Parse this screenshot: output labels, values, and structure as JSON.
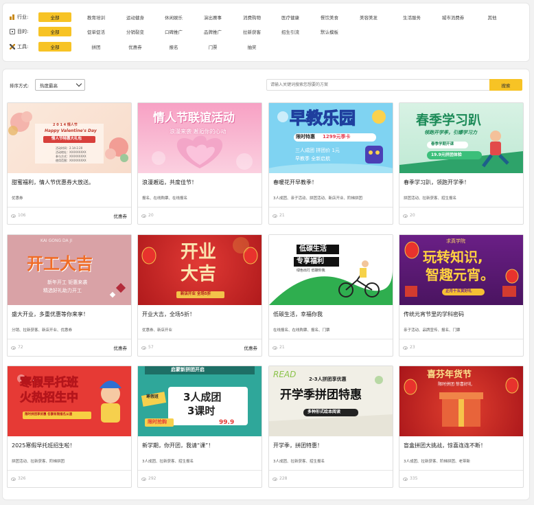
{
  "filters": {
    "industry": {
      "label": "行业:",
      "options": [
        "全部",
        "教育培训",
        "运动健身",
        "休闲娱乐",
        "演出赛事",
        "消费购物",
        "医疗健康",
        "餐饮美食",
        "美容美发",
        "生活服务",
        "城市消费券",
        "其他"
      ]
    },
    "goal": {
      "label": "目的:",
      "options": [
        "全部",
        "促单促活",
        "分销裂变",
        "口碑推广",
        "品牌推广",
        "拉新获客",
        "招生引流",
        "默认模板"
      ]
    },
    "tool": {
      "label": "工具:",
      "options": [
        "全部",
        "拼团",
        "优惠券",
        "报名",
        "门票",
        "抽奖"
      ]
    }
  },
  "sort": {
    "label": "排序方式:",
    "value": "热度最高"
  },
  "search": {
    "placeholder": "请输入关键词搜索您想要的方案",
    "button": "搜索"
  },
  "cards": [
    {
      "title": "甜蜜福利，情人节优惠券大放送。",
      "tags": "优惠券",
      "views": "106",
      "type": "优惠券"
    },
    {
      "title": "浪漫邂逅，共度佳节！",
      "tags": "报名、在线购票、在线报名",
      "views": "20",
      "type": ""
    },
    {
      "title": "春暖花开早教季！",
      "tags": "3人成团、亲子活动、拼团活动、新店开业、阶梯拼团",
      "views": "21",
      "type": ""
    },
    {
      "title": "春季学习趴，领跑开学季！",
      "tags": "拼团活动、拉新获客、招生报名",
      "views": "20",
      "type": ""
    },
    {
      "title": "盛大开业，多重优惠等你来享！",
      "tags": "分销、拉新获客、新店开业、优惠券",
      "views": "72",
      "type": "优惠券"
    },
    {
      "title": "开业大吉，全场5折！",
      "tags": "优惠券、新店开业",
      "views": "57",
      "type": "优惠券"
    },
    {
      "title": "低碳生活，幸福你我",
      "tags": "在线报名、在线购票、报名、门票",
      "views": "21",
      "type": ""
    },
    {
      "title": "传统元宵节里的学科密码",
      "tags": "亲子活动、品牌宣传、报名、门票",
      "views": "23",
      "type": ""
    },
    {
      "title": "2025寒假早托班招生啦！",
      "tags": "拼团活动、拉新获客、阶梯拼团",
      "views": "326",
      "type": ""
    },
    {
      "title": "新学期，你开团，我请“课”！",
      "tags": "3人成团、拉新获客、招生报名",
      "views": "292",
      "type": ""
    },
    {
      "title": "开学季，拼团特惠！",
      "tags": "3人成团、拉新获客、招生报名",
      "views": "228",
      "type": ""
    },
    {
      "title": "盲盒拼团大挑战，惊喜连连不断！",
      "tags": "3人成团、拉新获客、阶梯拼团、老带新",
      "views": "335",
      "type": ""
    }
  ],
  "posters": {
    "p1": {
      "l1": "2 0 1 4  情人节",
      "l2": "Happy Valentine's Day",
      "l3": "情人节特惠大礼包",
      "l4": "活动时间：2.14-2.20",
      "l5": "活动地址：XXXXXXXXX",
      "l6": "参与方式：XXXXXXXXX",
      "l7": "使用范围：XXXXXXXXX"
    },
    "p2": {
      "h": "情人节联谊活动",
      "s": "浪漫来袭 邂逅你的心动"
    },
    "p3": {
      "h": "早教乐园",
      "b1": "限时特惠",
      "b2": "1299元季卡",
      "s": "三人成团 拼团价 1元",
      "s2": "早教季 全新启航"
    },
    "p4": {
      "h": "春季学习趴",
      "s": "领跑开学季，引爆学习力",
      "b1": "春季学期开课",
      "b2": "19.9元拼团体验"
    },
    "p5": {
      "top": "KAI GONG DA JI",
      "h": "开工大吉",
      "s1": "新年开工 钜惠来袭",
      "s2": "精选好礼助力开工"
    },
    "p6": {
      "h1": "开业",
      "h2": "大吉",
      "b": "新店开业 全场5折"
    },
    "p7": {
      "h1": "低碳生活",
      "h2": "专享福利",
      "s": "绿色出行 低碳你我"
    },
    "p8": {
      "top": "求真学院",
      "h1": "玩转知识,",
      "h2": "智趣元宵。",
      "b": "正月十五赏好礼"
    },
    "p9": {
      "h1": "寒假早托班",
      "h2": "火热招生中",
      "b": "限时拼团享优惠 名额有限报名从速"
    },
    "p10": {
      "top": "启蒙新拼团开启",
      "sign": "寒假班",
      "h1": "3人成团",
      "h2": "3课时",
      "b": "限时抢购",
      "p": "99.9"
    },
    "p11": {
      "top": "READ",
      "s": "2-3人拼团享优惠",
      "h": "开学季拼团特惠",
      "b": "多种形式绘本阅读"
    },
    "p12": {
      "h": "喜芬年货节",
      "s": "限时拼团 惊喜好礼"
    }
  },
  "colors": {
    "accent": "#f7c325"
  }
}
